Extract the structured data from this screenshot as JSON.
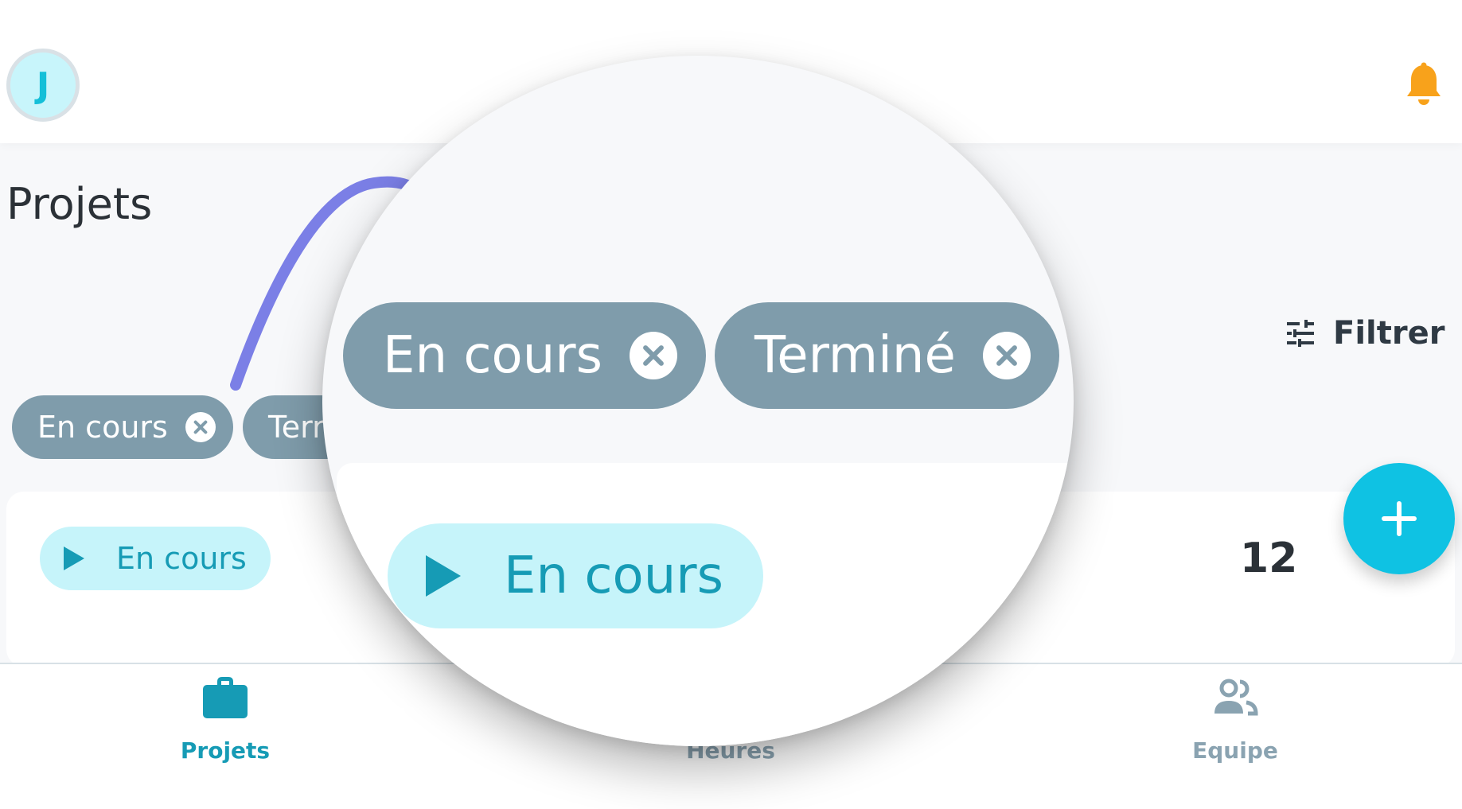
{
  "header": {
    "avatar_initial": "J",
    "bell_icon": "bell-icon",
    "bell_color": "#f8a21b"
  },
  "page": {
    "title": "Projets"
  },
  "filter": {
    "label": "Filtrer",
    "icon": "sliders-icon"
  },
  "chips": [
    {
      "label": "En cours"
    },
    {
      "label": "Terr"
    }
  ],
  "magnified_chips": [
    {
      "label": "En cours"
    },
    {
      "label": "Terminé"
    }
  ],
  "project": {
    "status": "En cours",
    "count": "12"
  },
  "fab": {
    "icon": "plus-icon"
  },
  "bottom_nav": {
    "items": [
      {
        "label": "Projets",
        "icon": "briefcase-icon",
        "active": true
      },
      {
        "label": "Heures",
        "icon": "clock-icon",
        "active": false
      },
      {
        "label": "Equipe",
        "icon": "team-icon",
        "active": false
      }
    ]
  },
  "colors": {
    "accent": "#0fc2e3",
    "chip_bg": "#7f9cab",
    "status_bg": "#c6f4fa",
    "status_text": "#169bb5",
    "nav_active": "#169bb5",
    "nav_inactive": "#8aa3b1",
    "annotation_arrow": "#7b7fe6"
  }
}
